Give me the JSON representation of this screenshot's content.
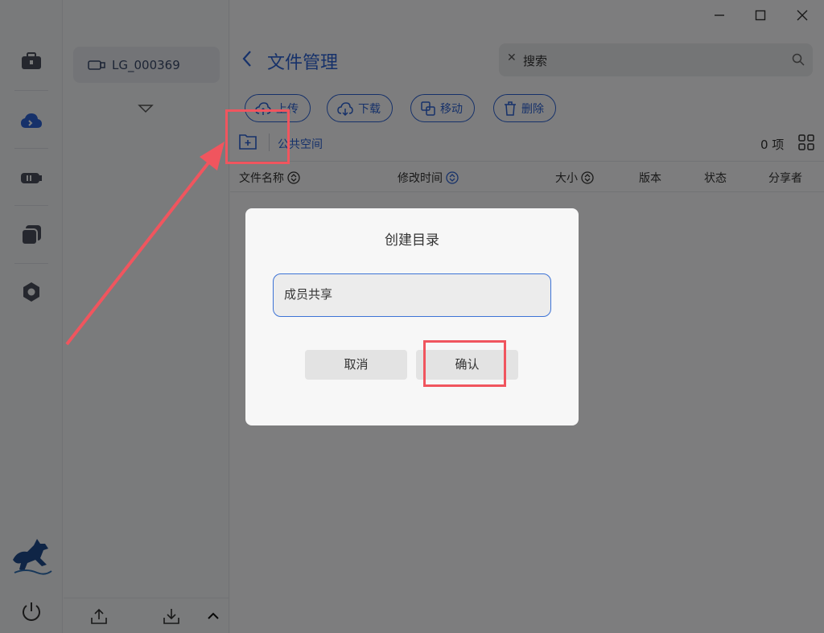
{
  "rail": {
    "icons": [
      "toolbox-icon",
      "cloud-icon",
      "drive-icon",
      "copy-icon",
      "settings-icon"
    ],
    "accent": "#2c62d4"
  },
  "tree": {
    "device_label": "LG_000369"
  },
  "window": {
    "minimize": "—",
    "maximize": "☐",
    "close": "✕"
  },
  "header": {
    "title": "文件管理",
    "search_value": "搜索",
    "search_clear": "✕"
  },
  "toolbar": {
    "upload": "上传",
    "download": "下载",
    "move": "移动",
    "delete": "删除"
  },
  "breadcrumb": {
    "path": "公共空间",
    "count": "0 项"
  },
  "table": {
    "columns": [
      "文件名称",
      "修改时间",
      "大小",
      "版本",
      "状态",
      "分享者"
    ]
  },
  "dialog": {
    "title": "创建目录",
    "input_value": "成员共享",
    "cancel": "取消",
    "confirm": "确认"
  },
  "colors": {
    "accent": "#2c62d4",
    "annotation": "#f0555e"
  }
}
